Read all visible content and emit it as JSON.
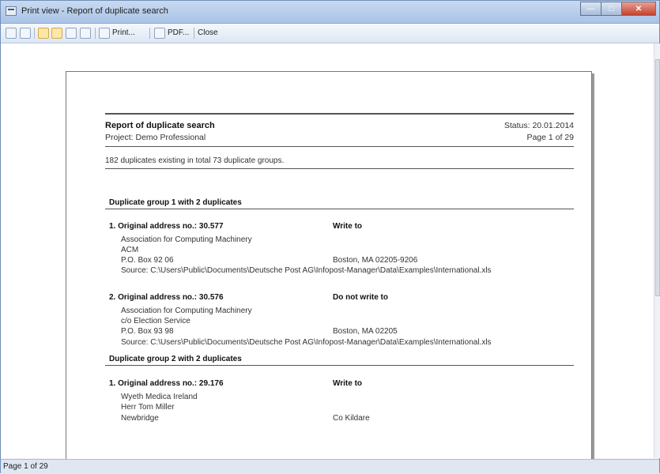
{
  "window": {
    "title": "Print view - Report of duplicate search"
  },
  "toolbar": {
    "print_label": "Print...",
    "pdf_label": "PDF...",
    "close_label": "Close"
  },
  "status": {
    "page_text": "Page 1 of 29"
  },
  "report": {
    "title": "Report of duplicate search",
    "project": "Project: Demo Professional",
    "status": "Status: 20.01.2014",
    "page": "Page 1 of 29",
    "summary": "182 duplicates existing in total 73 duplicate groups.",
    "groups": [
      {
        "heading": "Duplicate group 1 with 2 duplicates",
        "items": [
          {
            "header": "1. Original address no.: 30.577",
            "action": "Write to",
            "lines": [
              "Association for Computing Machinery",
              "ACM",
              "P.O. Box 92 06"
            ],
            "city": "Boston, MA 02205-9206",
            "source": "Source: C:\\Users\\Public\\Documents\\Deutsche Post AG\\Infopost-Manager\\Data\\Examples\\International.xls"
          },
          {
            "header": "2. Original address no.: 30.576",
            "action": "Do not write to",
            "lines": [
              "Association for Computing Machinery",
              "c/o Election Service",
              "P.O. Box 93 98"
            ],
            "city": "Boston, MA 02205",
            "source": "Source: C:\\Users\\Public\\Documents\\Deutsche Post AG\\Infopost-Manager\\Data\\Examples\\International.xls"
          }
        ]
      },
      {
        "heading": "Duplicate group 2 with 2 duplicates",
        "items": [
          {
            "header": "1. Original address no.: 29.176",
            "action": "Write to",
            "lines": [
              "Wyeth Medica Ireland",
              "Herr Tom Miller",
              "Newbridge"
            ],
            "city": "Co Kildare"
          }
        ]
      }
    ]
  }
}
